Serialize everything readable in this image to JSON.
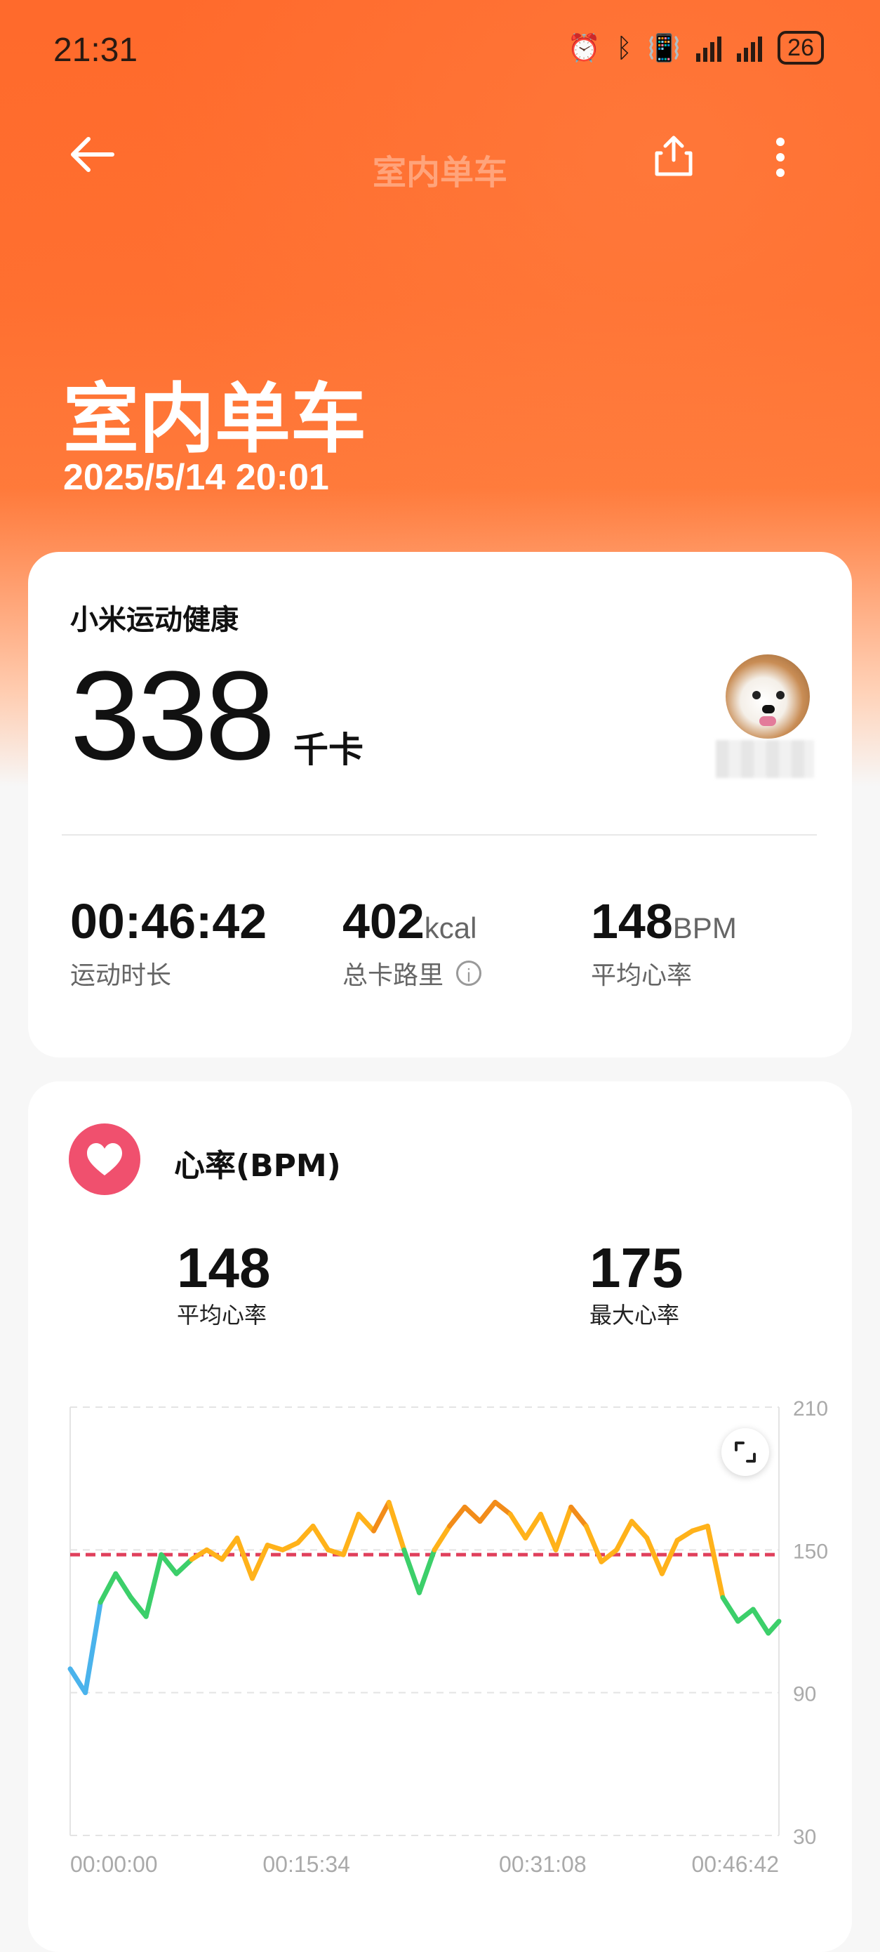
{
  "status_bar": {
    "time": "21:31",
    "battery": "26"
  },
  "header": {
    "title": "室内单车"
  },
  "workout": {
    "title": "室内单车",
    "datetime": "2025/5/14 20:01"
  },
  "summary": {
    "brand": "小米运动健康",
    "calories": "338",
    "calories_unit": "千卡",
    "stats": [
      {
        "value": "00:46:42",
        "unit": "",
        "label": "运动时长"
      },
      {
        "value": "402",
        "unit": "kcal",
        "label": "总卡路里"
      },
      {
        "value": "148",
        "unit": "BPM",
        "label": "平均心率"
      }
    ]
  },
  "heart_rate": {
    "title": "心率(BPM)",
    "avg_value": "148",
    "avg_label": "平均心率",
    "max_value": "175",
    "max_label": "最大心率"
  },
  "chart_data": {
    "type": "line",
    "title": "",
    "xlabel": "",
    "ylabel": "",
    "ylim": [
      30,
      210
    ],
    "yticks": [
      "210",
      "150",
      "90",
      "30"
    ],
    "xticks": [
      "00:00:00",
      "00:15:34",
      "00:31:08",
      "00:46:42"
    ],
    "reference_line": 148,
    "x_minutes": [
      0,
      1,
      2,
      3,
      4,
      5,
      6,
      7,
      8,
      9,
      10,
      11,
      12,
      13,
      14,
      15,
      16,
      17,
      18,
      19,
      20,
      21,
      22,
      23,
      24,
      25,
      26,
      27,
      28,
      29,
      30,
      31,
      32,
      33,
      34,
      35,
      36,
      37,
      38,
      39,
      40,
      41,
      42,
      43,
      44,
      45,
      46,
      46.7
    ],
    "values": [
      100,
      90,
      128,
      140,
      130,
      122,
      148,
      140,
      146,
      150,
      146,
      155,
      138,
      152,
      150,
      153,
      160,
      150,
      148,
      165,
      158,
      170,
      150,
      132,
      150,
      160,
      168,
      162,
      170,
      165,
      155,
      165,
      150,
      168,
      160,
      145,
      150,
      162,
      155,
      140,
      154,
      158,
      160,
      130,
      120,
      125,
      115,
      120
    ],
    "zone_colors": {
      "low": "#4ab3ec",
      "mid": "#3ccf6a",
      "high": "#ffb21a",
      "peak": "#f28c1a"
    },
    "colors": {
      "reference": "#e0405c",
      "grid": "#e4e4e4"
    }
  }
}
